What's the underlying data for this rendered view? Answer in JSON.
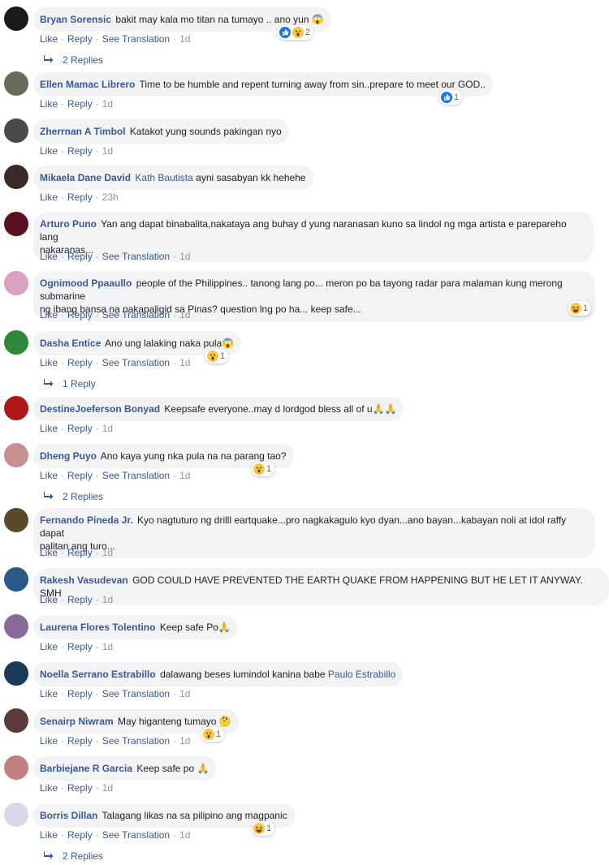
{
  "comments": [
    {
      "author": "Bryan Sorensic",
      "text": "bakit may kala mo titan na tumayo .. ano yun",
      "emoji": "😱",
      "actions": {
        "like": "Like",
        "reply": "Reply",
        "translate": "See Translation",
        "time": "1d"
      },
      "reactions": {
        "count": "2"
      },
      "replies": "2 Replies",
      "avatar_color": "#1a1a1a"
    },
    {
      "author": "Ellen Mamac Librero",
      "text": "Time to be humble and repent turning away from sin..prepare to meet our GOD..",
      "actions": {
        "like": "Like",
        "reply": "Reply",
        "time": "1d"
      },
      "reactions": {
        "count": "1"
      },
      "avatar_color": "#6b6b5a"
    },
    {
      "author": "Zherrnan A Timbol",
      "text": "Katakot yung sounds pakingan nyo",
      "actions": {
        "like": "Like",
        "reply": "Reply",
        "time": "1d"
      },
      "avatar_color": "#4a4a4a"
    },
    {
      "author": "Mikaela Dane David",
      "mention": "Kath Bautista",
      "text": "ayni sasabyan kk hehehe",
      "actions": {
        "like": "Like",
        "reply": "Reply",
        "time": "23h"
      },
      "avatar_color": "#3a2a28"
    },
    {
      "author": "Arturo Puno",
      "text": "Yan ang dapat binabalita,nakataya ang buhay d yung naranasan kuno sa lindol ng mga artista e parepareho lang",
      "text2": "nakaranas...",
      "actions": {
        "like": "Like",
        "reply": "Reply",
        "translate": "See Translation",
        "time": "1d"
      },
      "avatar_color": "#5a1020"
    },
    {
      "author": "Ognimood Ppaaullo",
      "text": "people of the Philippines.. tanong lang po... meron po ba tayong radar para malaman kung merong submarine",
      "text2": "ng ibang bansa na nakapaligid sa Pinas? question lng po ha... keep safe...",
      "actions": {
        "like": "Like",
        "reply": "Reply",
        "translate": "See Translation",
        "time": "1d"
      },
      "reactions": {
        "count": "1"
      },
      "avatar_color": "#d9a0c0"
    },
    {
      "author": "Dasha Entice",
      "text": "Ano ung lalaking naka pula",
      "emoji": "😱",
      "actions": {
        "like": "Like",
        "reply": "Reply",
        "translate": "See Translation",
        "time": "1d"
      },
      "reactions": {
        "count": "1"
      },
      "replies": "1 Reply",
      "avatar_color": "#2a8a3a"
    },
    {
      "author": "DestineJoeferson Bonyad",
      "text": "Keepsafe everyone..may d lordgod bless all of u",
      "emoji": "🙏🙏",
      "actions": {
        "like": "Like",
        "reply": "Reply",
        "time": "1d"
      },
      "avatar_color": "#b01818"
    },
    {
      "author": "Dheng Puyo",
      "text": "Ano kaya yung nka pula na na parang tao?",
      "actions": {
        "like": "Like",
        "reply": "Reply",
        "translate": "See Translation",
        "time": "1d"
      },
      "reactions": {
        "count": "1"
      },
      "replies": "2 Replies",
      "avatar_color": "#c89090"
    },
    {
      "author": "Fernando Pineda Jr.",
      "text": "Kyo nagtuturo ng drilll eartquake...pro nagkakagulo kyo dyan...ano bayan...kabayan noli at idol raffy dapat",
      "text2": "palitan ang turo...",
      "actions": {
        "like": "Like",
        "reply": "Reply",
        "time": "1d"
      },
      "avatar_color": "#5a4a2a"
    },
    {
      "author": "Rakesh Vasudevan",
      "text": "GOD COULD HAVE PREVENTED THE EARTH QUAKE FROM HAPPENING BUT HE LET IT ANYWAY. SMH",
      "actions": {
        "like": "Like",
        "reply": "Reply",
        "time": "1d"
      },
      "avatar_color": "#2a5a8a"
    },
    {
      "author": "Laurena Flores Tolentino",
      "text": "Keep safe Po",
      "emoji": "🙏",
      "actions": {
        "like": "Like",
        "reply": "Reply",
        "time": "1d"
      },
      "avatar_color": "#8a6a9a"
    },
    {
      "author": "Noella Serrano Estrabillo",
      "text": "dalawang beses lumindol kanina babe",
      "mention_after": "Paulo Estrabillo",
      "actions": {
        "like": "Like",
        "reply": "Reply",
        "translate": "See Translation",
        "time": "1d"
      },
      "avatar_color": "#1a3a5a"
    },
    {
      "author": "Senairp Niwram",
      "text": "May higanteng tumayo",
      "emoji": "🤔",
      "actions": {
        "like": "Like",
        "reply": "Reply",
        "translate": "See Translation",
        "time": "1d"
      },
      "reactions": {
        "count": "1"
      },
      "avatar_color": "#5a3a3a"
    },
    {
      "author": "Barbiejane R Garcia",
      "text": "Keep safe po",
      "emoji": "🙏",
      "actions": {
        "like": "Like",
        "reply": "Reply",
        "time": "1d"
      },
      "avatar_color": "#c08080"
    },
    {
      "author": "Borris Dillan",
      "text": "Talagang likas na sa pilipino ang magpanic",
      "actions": {
        "like": "Like",
        "reply": "Reply",
        "translate": "See Translation",
        "time": "1d"
      },
      "reactions": {
        "count": "1"
      },
      "replies": "2 Replies",
      "avatar_color": "#d8d8e8"
    }
  ],
  "colors": {
    "link": "#385898",
    "meta": "#90949c",
    "bubble": "#f2f3f5",
    "like_blue": "#1877f2",
    "wow_yellow": "#f7c744"
  }
}
